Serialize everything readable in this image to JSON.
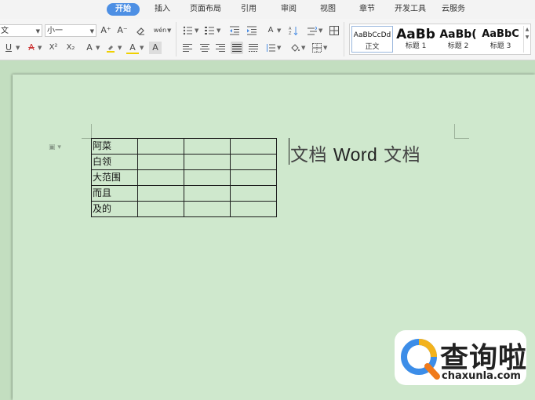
{
  "menu": {
    "tabs": [
      {
        "label": "开始",
        "active": true
      },
      {
        "label": "插入"
      },
      {
        "label": "页面布局"
      },
      {
        "label": "引用"
      },
      {
        "label": "审阅"
      },
      {
        "label": "视图"
      },
      {
        "label": "章节"
      },
      {
        "label": "开发工具"
      },
      {
        "label": "云服务"
      }
    ]
  },
  "ribbon": {
    "font_name": "文",
    "font_size": "小一",
    "font_btn_labels": {
      "grow": "A⁺",
      "shrink": "A⁻",
      "underline": "U",
      "strikethrough": "A",
      "superscript": "X²",
      "subscript": "X₂",
      "text_effect": "A",
      "font_color": "A",
      "char_shading": "A",
      "phonetic": "wén"
    },
    "styles": [
      {
        "preview": "AaBbCcDd",
        "name": "正文"
      },
      {
        "preview": "AaBb",
        "name": "标题 1"
      },
      {
        "preview": "AaBb(",
        "name": "标题 2"
      },
      {
        "preview": "AaBbC",
        "name": "标题 3"
      }
    ]
  },
  "document": {
    "table": [
      [
        "阿菜",
        "",
        "",
        ""
      ],
      [
        "白领",
        "",
        "",
        ""
      ],
      [
        "大范围",
        "",
        "",
        ""
      ],
      [
        "而且",
        "",
        "",
        ""
      ],
      [
        "及的",
        "",
        "",
        ""
      ]
    ],
    "text_part1": "文档 ",
    "text_part2": "Word",
    "text_part3": " 文档"
  },
  "watermark": {
    "brand_cn": "查询啦",
    "brand_url": "chaxunla.com"
  },
  "colors": {
    "page_bg": "#cfe8cd",
    "accent": "#4d8fe4"
  }
}
